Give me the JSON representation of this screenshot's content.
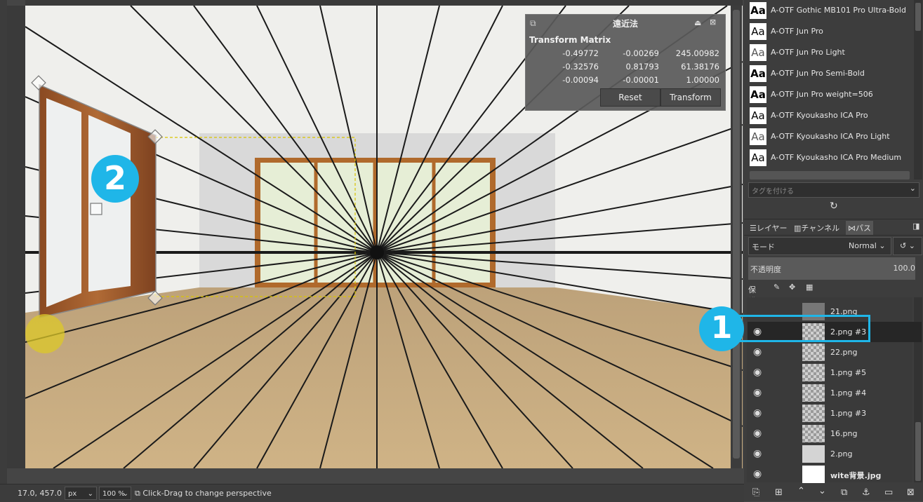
{
  "matrix_dialog": {
    "title": "遠近法",
    "subtitle": "Transform Matrix",
    "rows": [
      [
        "-0.49772",
        "-0.00269",
        "245.00982"
      ],
      [
        "-0.32576",
        "0.81793",
        "61.38176"
      ],
      [
        "-0.00094",
        "-0.00001",
        "1.00000"
      ]
    ],
    "reset_label": "Reset",
    "transform_label": "Transform"
  },
  "status_bar": {
    "coords": "17.0, 457.0",
    "unit": "px",
    "zoom": "100 %",
    "hint": "Click-Drag to change perspective"
  },
  "fonts": [
    "A-OTF Gothic MB101 Pro Ultra-Bold",
    "A-OTF Jun Pro",
    "A-OTF Jun Pro Light",
    "A-OTF Jun Pro Semi-Bold",
    "A-OTF Jun Pro weight=506",
    "A-OTF Kyoukasho ICA Pro",
    "A-OTF Kyoukasho ICA Pro Light",
    "A-OTF Kyoukasho ICA Pro Medium"
  ],
  "font_preview_glyph": "Aa",
  "tag_placeholder": "タグを付ける",
  "tabs": {
    "layers": "レイヤー",
    "channels": "チャンネル",
    "paths": "パス"
  },
  "mode_label": "モード",
  "mode_value": "Normal",
  "opacity_label": "不透明度",
  "opacity_value": "100.0",
  "lock_label": "保護:",
  "layers": [
    {
      "name": "21.png",
      "visible": false
    },
    {
      "name": "2.png #3",
      "visible": true,
      "selected": true
    },
    {
      "name": "22.png",
      "visible": true
    },
    {
      "name": "1.png #5",
      "visible": true
    },
    {
      "name": "1.png #4",
      "visible": true
    },
    {
      "name": "1.png #3",
      "visible": true
    },
    {
      "name": "16.png",
      "visible": true
    },
    {
      "name": "2.png",
      "visible": true
    },
    {
      "name": "wite背景.jpg",
      "visible": true
    }
  ],
  "callouts": {
    "one": "1",
    "two": "2"
  },
  "colors": {
    "highlight": "#1fb6e8",
    "badge": "#1fb6e8",
    "canvas_bg": "#eeeeea",
    "floor": "#c7ab7c"
  }
}
